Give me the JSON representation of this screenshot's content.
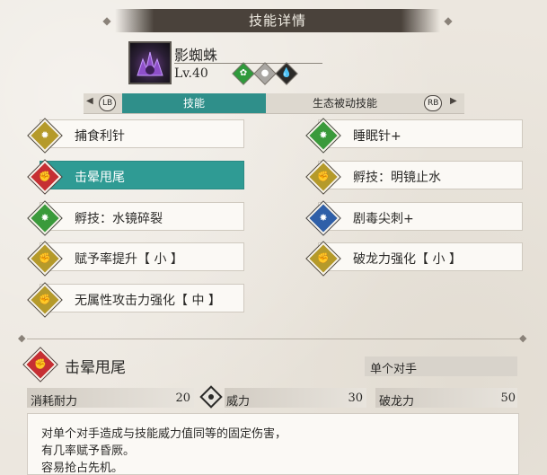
{
  "header": {
    "title": "技能详情"
  },
  "monster": {
    "name": "影蜘蛛",
    "level": "Lv.40",
    "elements": [
      "grass-icon",
      "neutral-icon",
      "water-icon"
    ]
  },
  "tabs": {
    "left_hint": "LB",
    "right_hint": "RB",
    "items": [
      {
        "label": "技能",
        "active": true
      },
      {
        "label": "生态被动技能",
        "active": false
      }
    ]
  },
  "skills": [
    {
      "label": "捕食利针",
      "icon": "gold"
    },
    {
      "label": "睡眠针+",
      "icon": "green"
    },
    {
      "label": "击晕甩尾",
      "icon": "red",
      "selected": true
    },
    {
      "label": "孵技：明镜止水",
      "icon": "gold"
    },
    {
      "label": "孵技：水镜碎裂",
      "icon": "green"
    },
    {
      "label": "剧毒尖刺+",
      "icon": "blue"
    },
    {
      "label": "赋予率提升【 小 】",
      "icon": "gold"
    },
    {
      "label": "破龙力强化【 小 】",
      "icon": "gold"
    },
    {
      "label": "无属性攻击力强化【 中 】",
      "icon": "gold"
    }
  ],
  "detail": {
    "name": "击晕甩尾",
    "target": "单个对手",
    "stats": {
      "cost_label": "消耗耐力",
      "cost_value": "20",
      "power_label": "威力",
      "power_value": "30",
      "dragon_label": "破龙力",
      "dragon_value": "50"
    },
    "description": [
      "对单个对手造成与技能威力值同等的固定伤害，",
      "有几率赋予昏厥。",
      "容易抢占先机。"
    ]
  },
  "colors": {
    "accent": "#2f9b94",
    "gold": "#b59a2a",
    "red": "#c62f33",
    "green": "#3a9a3b",
    "blue": "#2f5fa8"
  }
}
